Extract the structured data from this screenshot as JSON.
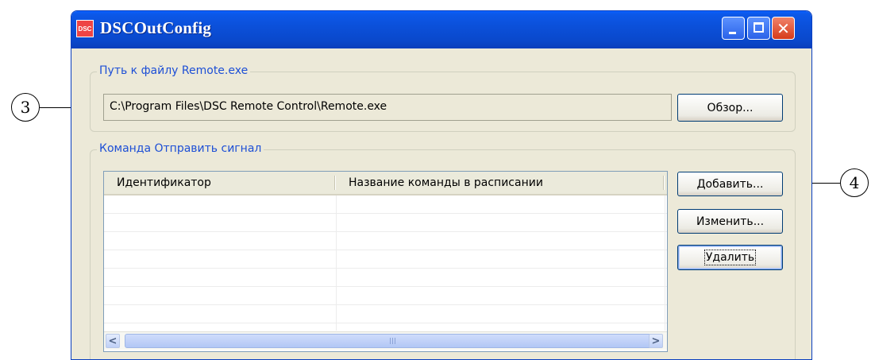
{
  "window": {
    "title": "DSCOutConfig",
    "icon_label": "DSC"
  },
  "callouts": [
    {
      "label": "3"
    },
    {
      "label": "4"
    }
  ],
  "path_group": {
    "legend": "Путь к файлу Remote.exe",
    "path_value": "C:\\Program Files\\DSC Remote Control\\Remote.exe",
    "browse_label": "Обзор..."
  },
  "command_group": {
    "legend": "Команда Отправить сигнал",
    "columns": [
      "Идентификатор",
      "Название команды в расписании"
    ],
    "rows": [],
    "add_label": "Добавить...",
    "edit_label": "Изменить...",
    "delete_label": "Удалить"
  },
  "scrollbar": {
    "left_arrow": "<",
    "right_arrow": ">"
  },
  "colors": {
    "titlebar": "#0b4fd8",
    "window_bg": "#ece9d8",
    "legend_text": "#1d4fd6"
  }
}
